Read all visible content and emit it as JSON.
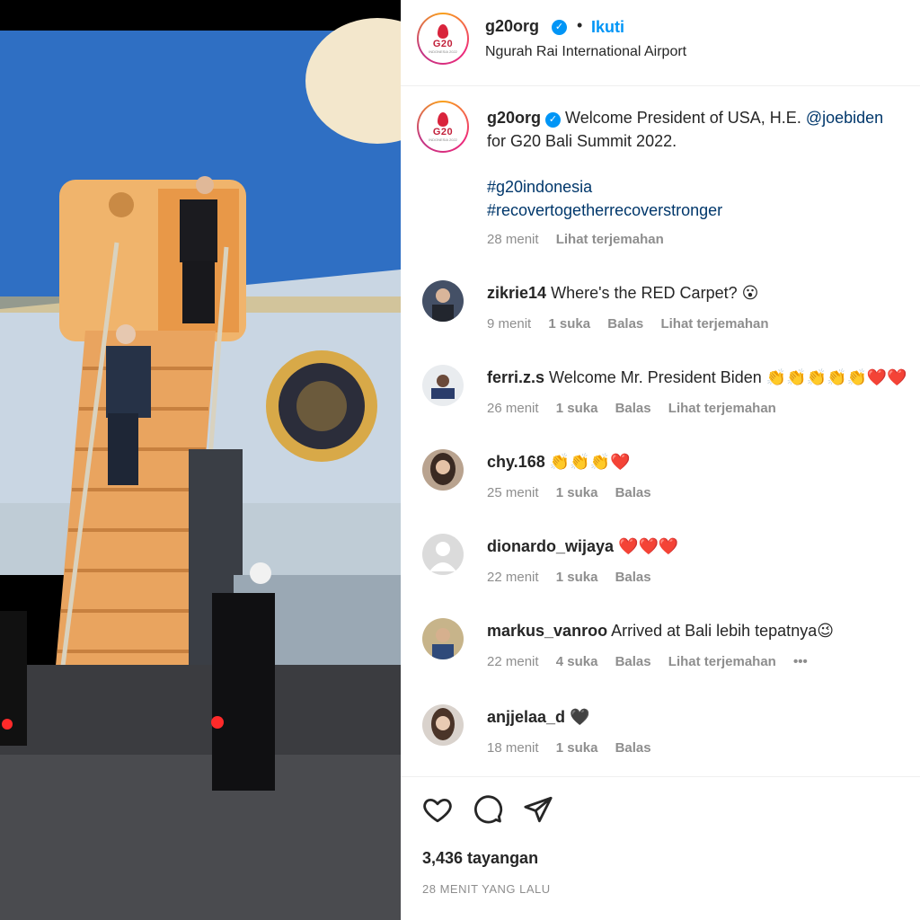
{
  "post": {
    "username": "g20org",
    "follow_label": "Ikuti",
    "separator": "•",
    "location": "Ngurah Rai International Airport",
    "avatar_logo": {
      "text": "G20",
      "sub": "INDONESIA 2022"
    }
  },
  "caption": {
    "username": "g20org",
    "text_prefix": "Welcome President of USA, H.E. ",
    "mention": "@joebiden",
    "text_line2": "for G20 Bali Summit 2022.",
    "hashtags": [
      "#g20indonesia",
      "#recovertogetherrecoverstronger"
    ],
    "time": "28 menit",
    "translate": "Lihat terjemahan"
  },
  "comments": [
    {
      "username": "zikrie14",
      "text": "Where's the RED Carpet? 😮",
      "time": "9 menit",
      "likes": "1 suka",
      "reply": "Balas",
      "translate": "Lihat terjemahan"
    },
    {
      "username": "ferri.z.s",
      "text": "Welcome Mr. President Biden 👏👏👏👏👏❤️❤️",
      "time": "26 menit",
      "likes": "1 suka",
      "reply": "Balas",
      "translate": "Lihat terjemahan"
    },
    {
      "username": "chy.168",
      "text": "👏👏👏❤️",
      "time": "25 menit",
      "likes": "1 suka",
      "reply": "Balas"
    },
    {
      "username": "dionardo_wijaya",
      "text": "❤️❤️❤️",
      "time": "22 menit",
      "likes": "1 suka",
      "reply": "Balas"
    },
    {
      "username": "markus_vanroo",
      "text": "Arrived at Bali lebih tepatnya😉",
      "time": "22 menit",
      "likes": "4 suka",
      "reply": "Balas",
      "translate": "Lihat terjemahan",
      "more": "•••"
    },
    {
      "username": "anjjelaa_d",
      "text": "🖤",
      "time": "18 menit",
      "likes": "1 suka",
      "reply": "Balas"
    }
  ],
  "footer": {
    "views": "3,436 tayangan",
    "time_ago": "28 MENIT YANG LALU"
  },
  "icons": [
    "verified-badge-icon",
    "heart-icon",
    "comment-icon",
    "share-icon",
    "more-icon"
  ],
  "colors": {
    "link_blue": "#0095f6",
    "hashtag_blue": "#00376b",
    "muted": "#8e8e8e",
    "heart_red": "#ed1c3a"
  }
}
